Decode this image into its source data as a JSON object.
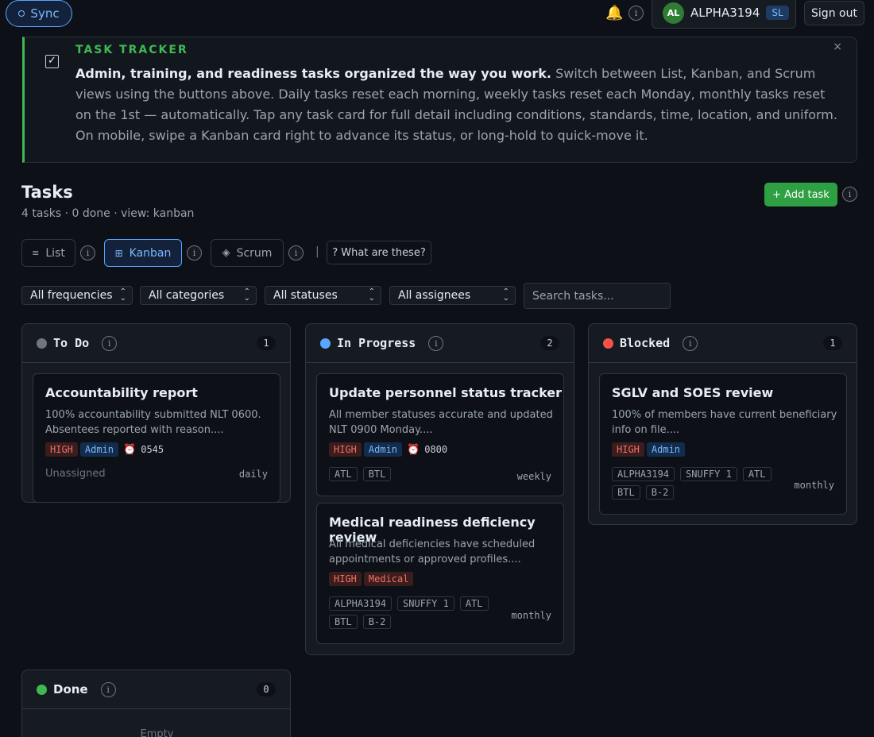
{
  "topbar": {
    "sync_label": "Sync",
    "user_initials": "AL",
    "user_name": "ALPHA3194",
    "rank": "SL",
    "signout_label": "Sign out"
  },
  "banner": {
    "title": "TASK TRACKER",
    "lead": "Admin, training, and readiness tasks organized the way you work.",
    "body": " Switch between List, Kanban, and Scrum views using the buttons above. Daily tasks reset each morning, weekly tasks reset each Monday, monthly tasks reset on the 1st — automatically. Tap any task card for full detail including conditions, standards, time, location, and uniform. On mobile, swipe a Kanban card right to advance its status, or long-hold to quick-move it.",
    "close": "×"
  },
  "tasks": {
    "title": "Tasks",
    "subtitle": "4 tasks · 0 done · view: kanban",
    "add_label": "+ Add task"
  },
  "views": {
    "list": "List",
    "kanban": "Kanban",
    "scrum": "Scrum",
    "separator": "|",
    "what": "? What are these?"
  },
  "filters": {
    "frequency": "All frequencies",
    "category": "All categories",
    "status": "All statuses",
    "assignee": "All assignees",
    "search_placeholder": "Search tasks..."
  },
  "columns": [
    {
      "name": "To Do",
      "count": "1",
      "color": "#6e7681",
      "cards": [
        {
          "title": "Accountability report",
          "desc": "100% accountability submitted NLT 0600. Absentees reported with reason....",
          "priority": "HIGH",
          "category": "Admin",
          "time": "0545",
          "assignee": "Unassigned",
          "freq": "daily"
        }
      ]
    },
    {
      "name": "In Progress",
      "count": "2",
      "color": "#58a6ff",
      "cards": [
        {
          "title": "Update personnel status tracker",
          "desc": "All member statuses accurate and updated NLT 0900 Monday....",
          "priority": "HIGH",
          "category": "Admin",
          "time": "0800",
          "assignees": [
            "ATL",
            "BTL"
          ],
          "freq": "weekly"
        },
        {
          "title": "Medical readiness deficiency review",
          "desc": "All medical deficiencies have scheduled appointments or approved profiles....",
          "priority": "HIGH",
          "category": "Medical",
          "assignees": [
            "ALPHA3194",
            "SNUFFY 1",
            "ATL",
            "BTL",
            "B-2"
          ],
          "freq": "monthly"
        }
      ]
    },
    {
      "name": "Blocked",
      "count": "1",
      "color": "#f85149",
      "cards": [
        {
          "title": "SGLV and SOES review",
          "desc": "100% of members have current beneficiary info on file....",
          "priority": "HIGH",
          "category": "Admin",
          "assignees": [
            "ALPHA3194",
            "SNUFFY 1",
            "ATL",
            "BTL",
            "B-2"
          ],
          "freq": "monthly"
        }
      ]
    },
    {
      "name": "Done",
      "count": "0",
      "color": "#3fb950",
      "empty": "Empty"
    }
  ],
  "info_glyph": "i"
}
